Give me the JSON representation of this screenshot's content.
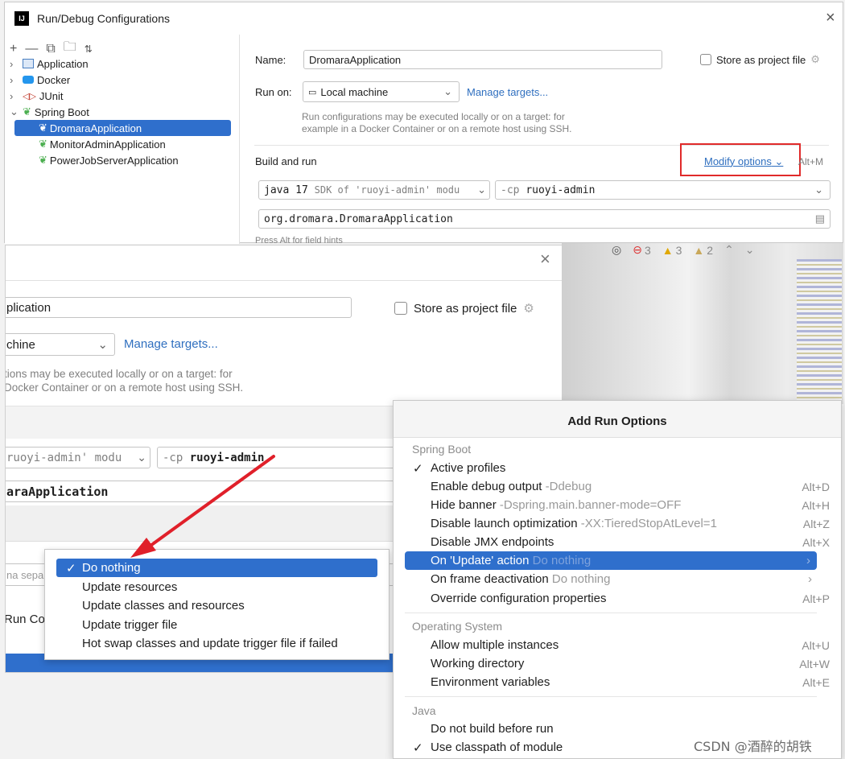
{
  "window": {
    "title": "Run/Debug Configurations"
  },
  "tree": {
    "items": [
      {
        "label": "Application"
      },
      {
        "label": "Docker"
      },
      {
        "label": "JUnit"
      },
      {
        "label": "Spring Boot"
      },
      {
        "label": "DromaraApplication"
      },
      {
        "label": "MonitorAdminApplication"
      },
      {
        "label": "PowerJobServerApplication"
      }
    ]
  },
  "form": {
    "name_label": "Name:",
    "name_value": "DromaraApplication",
    "store_label": "Store as project file",
    "run_on_label": "Run on:",
    "run_on_value": "Local machine",
    "manage_targets": "Manage targets...",
    "run_on_hint_1": "Run configurations may be executed locally or on a target: for",
    "run_on_hint_2": "example in a Docker Container or on a remote host using SSH.",
    "build_run_label": "Build and run",
    "modify_options": "Modify options",
    "modify_shortcut": "Alt+M",
    "jdk_prefix": "java 17",
    "jdk_suffix": "SDK of 'ruoyi-admin' modu",
    "cp_prefix": "-cp",
    "cp_value": "ruoyi-admin",
    "main_class": "org.dromara.DromaraApplication",
    "field_hints": "Press Alt for field hints"
  },
  "status": {
    "errors": "3",
    "warnings": "3",
    "weak_warnings": "2"
  },
  "zoom": {
    "name_value": "plication",
    "store_label": "Store as project file",
    "run_on_value": "chine",
    "manage_targets": "Manage targets...",
    "hint_1": "tions may be executed locally or on a target: for",
    "hint_2": "Docker Container or on a remote host using SSH.",
    "jdk_suffix": "ruoyi-admin' modu",
    "cp_prefix": "-cp",
    "cp_value": "ruoyi-admin",
    "main_class": "araApplication",
    "frag_sep": "na sepa",
    "frag_runco": "Run Co"
  },
  "update_dropdown": {
    "items": [
      {
        "label": "Do nothing",
        "checked": true
      },
      {
        "label": "Update resources",
        "checked": false
      },
      {
        "label": "Update classes and resources",
        "checked": false
      },
      {
        "label": "Update trigger file",
        "checked": false
      },
      {
        "label": "Hot swap classes and update trigger file if failed",
        "checked": false
      }
    ]
  },
  "add_run_options": {
    "title": "Add Run Options",
    "sections": [
      {
        "name": "Spring Boot",
        "items": [
          {
            "label": "Active profiles",
            "hint": "",
            "shortcut": "",
            "checked": true
          },
          {
            "label": "Enable debug output",
            "hint": "-Ddebug",
            "shortcut": "Alt+D"
          },
          {
            "label": "Hide banner",
            "hint": "-Dspring.main.banner-mode=OFF",
            "shortcut": "Alt+H"
          },
          {
            "label": "Disable launch optimization",
            "hint": "-XX:TieredStopAtLevel=1",
            "shortcut": "Alt+Z"
          },
          {
            "label": "Disable JMX endpoints",
            "hint": "",
            "shortcut": "Alt+X"
          },
          {
            "label": "On 'Update' action",
            "hint": "Do nothing",
            "shortcut": "",
            "selected": true
          },
          {
            "label": "On frame deactivation",
            "hint": "Do nothing",
            "shortcut": ""
          },
          {
            "label": "Override configuration properties",
            "hint": "",
            "shortcut": "Alt+P"
          }
        ]
      },
      {
        "name": "Operating System",
        "items": [
          {
            "label": "Allow multiple instances",
            "shortcut": "Alt+U"
          },
          {
            "label": "Working directory",
            "shortcut": "Alt+W"
          },
          {
            "label": "Environment variables",
            "shortcut": "Alt+E"
          }
        ]
      },
      {
        "name": "Java",
        "items": [
          {
            "label": "Do not build before run",
            "shortcut": ""
          },
          {
            "label": "Use classpath of module",
            "shortcut": "",
            "checked": true
          }
        ]
      }
    ]
  },
  "watermark": "CSDN @酒醉的胡铁",
  "colors": {
    "selection": "#2f6fcc",
    "link": "#2f6fbf",
    "red_box": "#e02a2a",
    "arrow": "#e0202a"
  }
}
